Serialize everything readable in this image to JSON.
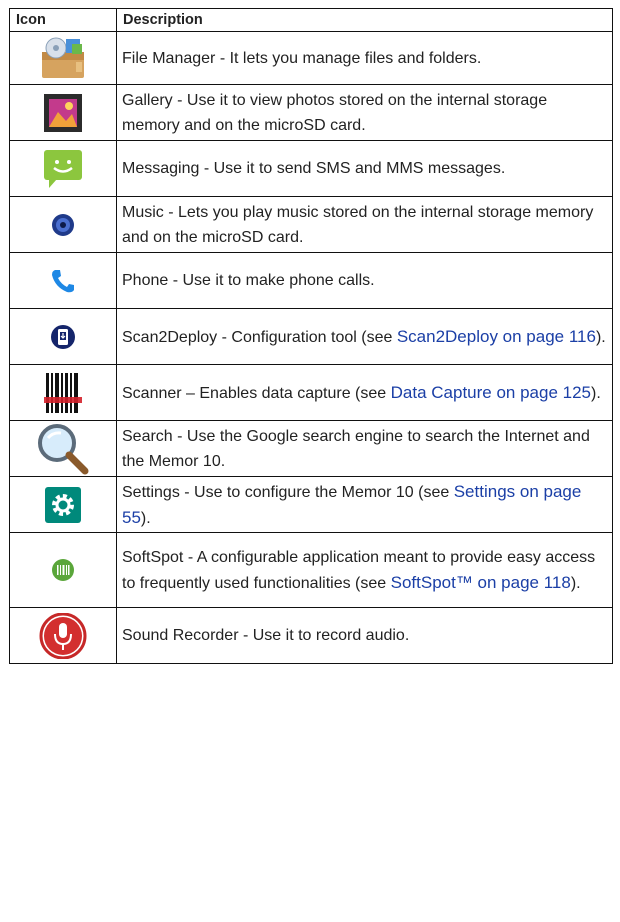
{
  "table": {
    "headers": [
      "Icon",
      "Description"
    ],
    "rows": [
      {
        "icon": "file-manager-icon",
        "parts": [
          {
            "t": "File Manager - It lets you manage files and folders."
          }
        ]
      },
      {
        "icon": "gallery-icon",
        "parts": [
          {
            "t": "Gallery - Use it to view photos stored on the internal storage memory and on the microSD card."
          }
        ]
      },
      {
        "icon": "messaging-icon",
        "parts": [
          {
            "t": "Messaging - Use it to send SMS and MMS messages."
          }
        ]
      },
      {
        "icon": "music-icon",
        "parts": [
          {
            "t": "Music - Lets you play music stored on the internal storage memory and on the microSD card."
          }
        ]
      },
      {
        "icon": "phone-icon",
        "parts": [
          {
            "t": "Phone - Use it to make phone calls."
          }
        ]
      },
      {
        "icon": "scan2deploy-icon",
        "parts": [
          {
            "t": "Scan2Deploy - Configuration tool (see "
          },
          {
            "t": "Scan2Deploy on page 116",
            "link": true
          },
          {
            "t": ")."
          }
        ]
      },
      {
        "icon": "scanner-icon",
        "parts": [
          {
            "t": "Scanner – Enables data capture (see "
          },
          {
            "t": "Data Capture on page 125",
            "link": true
          },
          {
            "t": ")."
          }
        ]
      },
      {
        "icon": "search-icon",
        "parts": [
          {
            "t": "Search - Use the Google search engine to search the Internet and the Memor 10."
          }
        ]
      },
      {
        "icon": "settings-icon",
        "parts": [
          {
            "t": "Settings - Use to configure the Memor 10 (see "
          },
          {
            "t": "Settings on page 55",
            "link": true
          },
          {
            "t": ")."
          }
        ]
      },
      {
        "icon": "softspot-icon",
        "parts": [
          {
            "t": "SoftSpot - A configurable application meant to provide easy access to frequently used functionalities (see "
          },
          {
            "t": "SoftSpot™ on page 118",
            "link": true
          },
          {
            "t": ")."
          }
        ]
      },
      {
        "icon": "sound-recorder-icon",
        "parts": [
          {
            "t": "Sound Recorder - Use it to record audio."
          }
        ]
      }
    ]
  }
}
